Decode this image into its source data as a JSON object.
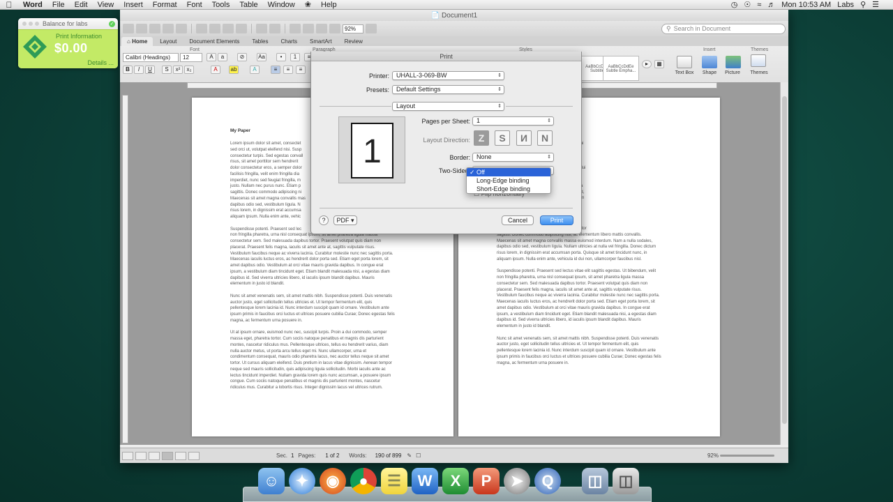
{
  "menubar": {
    "app": "Word",
    "items": [
      "File",
      "Edit",
      "View",
      "Insert",
      "Format",
      "Font",
      "Tools",
      "Table",
      "Window",
      "Help"
    ],
    "clock": "Mon 10:53 AM",
    "user": "Labs"
  },
  "print_widget": {
    "title": "Balance for labs",
    "subtitle": "Print Information",
    "amount": "$0.00",
    "details": "Details ..."
  },
  "window": {
    "title": "Document1",
    "zoom": "92%",
    "search_placeholder": "Search in Document",
    "tabs": [
      "Home",
      "Layout",
      "Document Elements",
      "Tables",
      "Charts",
      "SmartArt",
      "Review"
    ]
  },
  "ribbon": {
    "groups": [
      "Font",
      "Paragraph",
      "Styles",
      "Insert",
      "Themes"
    ],
    "font_name": "Calibri (Headings)",
    "font_size": "12",
    "styles": [
      "AaBbCcDdE",
      "AaBbCcDdEe"
    ],
    "style_names": [
      "Subtitle",
      "Subtle Empha..."
    ],
    "insert_labels": [
      "Text Box",
      "Shape",
      "Picture"
    ],
    "themes_label": "Themes"
  },
  "document": {
    "heading": "My Paper",
    "page1": [
      "Lorem ipsum dolor sit amet, consectet",
      "sed orci ut, volutpat eleifend nisi. Susp",
      "consectetur turpis. Sed egestas convall",
      "risus, sit amet porttitor sem hendrerit",
      "dolor consectetur eros, a semper dolor",
      "facilisis fringilla, velit enim fringilla dia",
      "imperdiet, nunc sed feugiat fringilla, m",
      "justo. Nullam nec purus nunc. Etiam p",
      "sagittis. Donec commodo adipiscing ni",
      "Maecenas sit amet magna convallis mas",
      "dapibus odio sed, vestibulum ligula. N",
      "risus lorem, in dignissim erat accumsa",
      "aliquam ipsum. Nulla enim ante, vehic",
      "",
      "Suspendisse potenti. Praesent sed lec",
      "non fringilla pharetra, urna nisl consequat ipsum, sit amet pharetra ligula massa",
      "consectetur sem. Sed malesuada dapibus tortor. Praesent volutpat quis diam non",
      "placerat. Praesent felis magna, iaculis sit amet ante at, sagittis vulputate risus.",
      "Vestibulum faucibus neque ac viverra lacinia. Curabitur molestie nunc nec sagittis porta.",
      "Maecenas iaculis luctus eros, ac hendrerit dolor porta sed. Etiam eget porta lorem, sit",
      "amet dapibus odio. Vestibulum at orci vitae mauris gravida dapibus. In congue erat",
      "ipsum, a vestibulum diam tincidunt eget. Etiam blandit malesuada nisi, a egestas diam",
      "dapibus id. Sed viverra ultricies libero, id iaculis ipsum blandit dapibus. Mauris",
      "elementum in justo id blandit.",
      "",
      "Nunc sit amet venenatis sem, sit amet mattis nibh. Suspendisse potenti. Duis venenatis",
      "auctor justo, eget sollicitudin tellus ultricies et. Ut tempor fermentum elit, quis",
      "pellentesque lorem lacinia id. Nunc interdum suscipit quam id ornare. Vestibulum ante",
      "ipsum primis in faucibus orci luctus et ultrices posuere cubilia Curae; Donec egestas felis",
      "magna, ac fermentum urna posuere in.",
      "",
      "Ut at ipsum ornare, euismod nunc nec, suscipit turpis. Proin a dui commodo, semper",
      "massa eget, pharetra tortor. Cum sociis natoque penatibus et magnis dis parturient",
      "montes, nascetur ridiculus mus. Pellentesque ultrices, tellus eu hendrerit varius, diam",
      "nulla auctor metus, ut porta arcu tellus eget mi. Nunc ullamcorper, urna et",
      "condimentum consequat, mauris odio pharetra lacus, nec auctor tellus neque sit amet",
      "tortor. Ut cursus aliquam eleifend. Duis pretium in lacus vitae dignissim. Aenean tempor",
      "neque sed mauris sollicitudin, quis adipiscing ligula sollicitudin. Morbi iaculis ante ac",
      "lectus tincidunt imperdiet. Nullam gravida lorem quis nunc accumsan, a posuere ipsum",
      "congue. Cum sociis natoque penatibus et magnis dis parturient montes, nascetur",
      "ridiculus mus. Curabitur a lobortis risus. Integer dignissim lacus vel ultrices rutrum."
    ],
    "page2": [
      "diam non turpis tincidunt, sed tristique leo",
      "disse id mauris dignissim, vel laoreet ac nisi",
      "diam interdum ut ac purus. Sed ullamcorper mi",
      "massa interdum. Cras vitae libero nec ante",
      "nunc sit luctus. Integer faucibus massa id",
      "bus. Integer imperdiet viverra suscipit.",
      "sit amet, hendrerit iaculis sem. Nulla gravida dui",
      "imperdiet justo.",
      "",
      "adipiscing elit. Donec risus mauris, malesuada",
      "disse id mauris dignissim, venenatis purus sed,",
      "dui sit amet accumsan. Cras ultrices accumsan",
      "Duis dictum, felis eget semper tincidunt, erat",
      "posuere ante. Morbi fringilla, justo eu",
      "nec tincidunt dolor dui lobortis sem. Integer",
      "turpis ornare diam, in suscipit mi magna non",
      "risus nunc a mauris dignissim, non facilisis tortor",
      "sagittis. Donec commodo adipiscing nisl, ac elementum libero mattis convallis.",
      "Maecenas sit amet magna convallis massa euismod interdum. Nam a nulla sodales,",
      "dapibus odio sed, vestibulum ligula. Nullam ultricies at nulla vel fringilla. Donec dictum",
      "risus lorem, in dignissim erat accumsan porta. Quisque sit amet tincidunt nunc, in",
      "aliquam ipsum. Nulla enim ante, vehicula id dui non, ullamcorper faucibus nisl.",
      "",
      "Suspendisse potenti. Praesent sed lectus vitae elit sagittis egestas. Ut bibendum, velit",
      "non fringilla pharetra, urna nisl consequat ipsum, sit amet pharetra ligula massa",
      "consectetur sem. Sed malesuada dapibus tortor. Praesent volutpat quis diam non",
      "placerat. Praesent felis magna, iaculis sit amet ante at, sagittis vulputate risus.",
      "Vestibulum faucibus neque ac viverra lacinia. Curabitur molestie nunc nec sagittis porta.",
      "Maecenas iaculis luctus eros, ac hendrerit dolor porta sed. Etiam eget porta lorem, sit",
      "amet dapibus odio. Vestibulum at orci vitae mauris gravida dapibus. In congue erat",
      "ipsum, a vestibulum diam tincidunt eget. Etiam blandit malesuada nisi, a egestas diam",
      "dapibus id. Sed viverra ultricies libero, id iaculis ipsum blandit dapibus. Mauris",
      "elementum in justo id blandit.",
      "",
      "Nunc sit amet venenatis sem, sit amet mattis nibh. Suspendisse potenti. Duis venenatis",
      "auctor justo, eget sollicitudin tellus ultricies et. Ut tempor fermentum elit, quis",
      "pellentesque lorem lacinia id. Nunc interdum suscipit quam id ornare. Vestibulum ante",
      "ipsum primis in faucibus orci luctus et ultrices posuere cubilia Curae; Donec egestas felis",
      "magna, ac fermentum urna posuere in."
    ]
  },
  "status": {
    "sec_label": "Sec.",
    "sec_value": "1",
    "pages_label": "Pages:",
    "pages_value": "1 of 2",
    "words_label": "Words:",
    "words_value": "190 of 899",
    "zoom": "92%"
  },
  "print_dialog": {
    "title": "Print",
    "printer_label": "Printer:",
    "printer_value": "UHALL-3-069-BW",
    "presets_label": "Presets:",
    "presets_value": "Default Settings",
    "section_value": "Layout",
    "preview_page": "1",
    "pages_per_sheet_label": "Pages per Sheet:",
    "pages_per_sheet_value": "1",
    "layout_direction_label": "Layout Direction:",
    "border_label": "Border:",
    "border_value": "None",
    "two_sided_label": "Two-Sided:",
    "flip_label": "Flip horizontally",
    "two_sided_options": [
      "Off",
      "Long-Edge binding",
      "Short-Edge binding"
    ],
    "two_sided_selected": "Off",
    "help": "?",
    "pdf_label": "PDF",
    "cancel_label": "Cancel",
    "print_label": "Print"
  }
}
